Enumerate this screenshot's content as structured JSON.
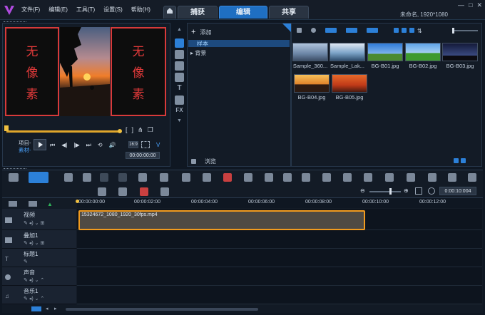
{
  "menu": {
    "file": "文件(F)",
    "edit": "编辑(E)",
    "tools": "工具(T)",
    "settings": "设置(S)",
    "help": "帮助(H)"
  },
  "tabs": {
    "capture": "捕获",
    "edit": "编辑",
    "share": "共享"
  },
  "project_info": "未命名, 1920*1080",
  "preview": {
    "no_image_label_left": [
      "无",
      "像",
      "素"
    ],
    "no_image_label_right": [
      "无",
      "像",
      "素"
    ],
    "mode_project": "项目-",
    "mode_clip": "素材-",
    "timecode": "00:00:00:00",
    "ratio": "16:9"
  },
  "library": {
    "add_label": "添加",
    "folders": [
      "样本",
      "背景"
    ],
    "browse_label": "浏览"
  },
  "thumbnails": [
    {
      "name": "Sample_360...",
      "color": "#8aa7c8"
    },
    {
      "name": "Sample_Lak...",
      "color": "#6c93b8"
    },
    {
      "name": "BG-B01.jpg",
      "color": "#3b7ed1"
    },
    {
      "name": "BG-B02.jpg",
      "color": "#2f8a3c"
    },
    {
      "name": "BG-B03.jpg",
      "color": "#28325a"
    },
    {
      "name": "BG-B04.jpg",
      "color": "#c2742a"
    },
    {
      "name": "BG-B05.jpg",
      "color": "#b84b1e"
    }
  ],
  "timeline": {
    "timecode": "0:00:10:004",
    "ruler": [
      "00:00:00:00",
      "00:00:02:00",
      "00:00:04:00",
      "00:00:06:00",
      "00:00:08:00",
      "00:00:10:00",
      "00:00:12:00"
    ],
    "tracks": [
      "视频",
      "叠加1",
      "标题1",
      "声音",
      "音乐1"
    ],
    "clip_name": "15324672_1080_1920_30fps.mp4"
  }
}
